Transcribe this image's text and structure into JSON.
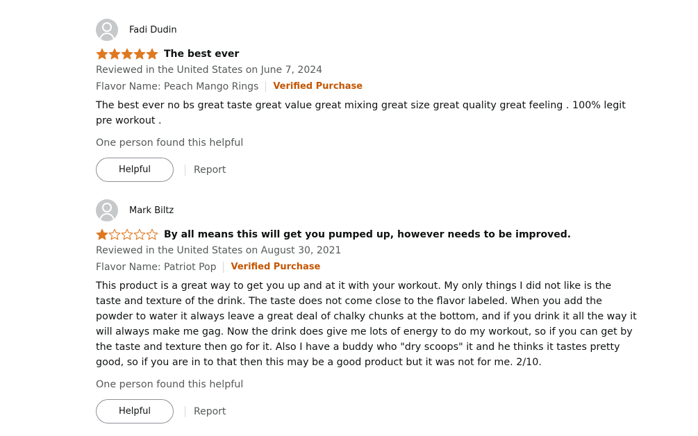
{
  "colors": {
    "star_fill": "#de7921",
    "star_outline": "#de7921",
    "verified": "#c45500",
    "secondary_text": "#565959"
  },
  "reviews": [
    {
      "profile_name": "Fadi Dudin",
      "rating": 5,
      "title": "The best ever",
      "date": "Reviewed in the United States on June 7, 2024",
      "flavor": "Flavor Name: Peach Mango Rings",
      "verified": "Verified Purchase",
      "body": "The best ever no bs great taste great value great mixing great size great quality great feeling . 100% legit pre workout .",
      "helpful_text": "One person found this helpful",
      "helpful_button": "Helpful",
      "report_link": "Report"
    },
    {
      "profile_name": "Mark Biltz",
      "rating": 1,
      "title": "By all means this will get you pumped up, however needs to be improved.",
      "date": "Reviewed in the United States on August 30, 2021",
      "flavor": "Flavor Name: Patriot Pop",
      "verified": "Verified Purchase",
      "body": "This product is a great way to get you up and at it with your workout. My only things I did not like is the taste and texture of the drink. The taste does not come close to the flavor labeled. When you add the powder to water it always leave a great deal of chalky chunks at the bottom, and if you drink it all the way it will always make me gag. Now the drink does give me lots of energy to do my workout, so if you can get by the taste and texture then go for it. Also I have a buddy who \"dry scoops\" it and he thinks it tastes pretty good, so if you are in to that then this may be a good product but it was not for me. 2/10.",
      "helpful_text": "One person found this helpful",
      "helpful_button": "Helpful",
      "report_link": "Report"
    }
  ]
}
